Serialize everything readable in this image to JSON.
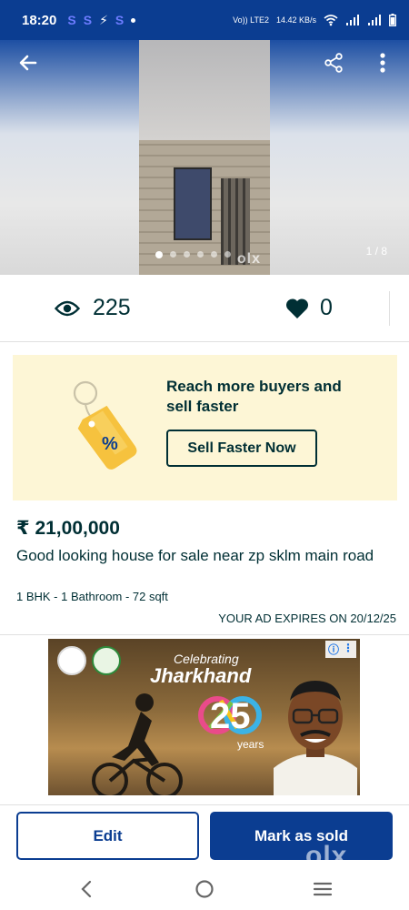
{
  "status_bar": {
    "time": "18:20",
    "notifications": [
      "S",
      "S",
      "⚡",
      "S"
    ],
    "network_label_1": "Vo)) LTE2",
    "network_label_2": "14.42 KB/s"
  },
  "toolbar": {
    "back_icon": "arrow-left-icon",
    "share_icon": "share-icon",
    "menu_icon": "more-vert-icon"
  },
  "gallery": {
    "counter": "1 / 8",
    "total_dots": 6,
    "active_dot": 0,
    "watermark": "olx"
  },
  "stats": {
    "views": "225",
    "likes": "0"
  },
  "promo": {
    "title": "Reach more buyers and sell faster",
    "button_label": "Sell Faster Now",
    "tag_text": "%"
  },
  "ad": {
    "price": "₹ 21,00,000",
    "title": "Good looking house for sale near zp sklm main road",
    "meta": "1 BHK - 1 Bathroom - 72 sqft",
    "expiry": "YOUR AD EXPIRES ON 20/12/25"
  },
  "banner": {
    "celebrating": "Celebrating",
    "state": "Jharkhand",
    "years": "years",
    "number": "25"
  },
  "actions": {
    "edit_label": "Edit",
    "sold_label": "Mark as sold"
  },
  "colors": {
    "primary": "#0b3d91",
    "text": "#002f34",
    "promo_bg": "#fdf6d6",
    "tag": "#f6c23e"
  }
}
